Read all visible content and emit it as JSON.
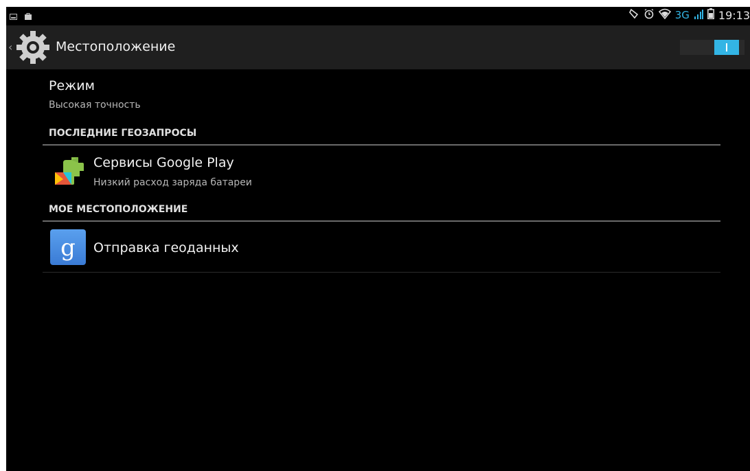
{
  "status_bar": {
    "icons_left": [
      "image-icon",
      "shopping-bag-icon"
    ],
    "icons_right": [
      "rotation-lock-icon",
      "alarm-icon",
      "wifi-icon",
      "signal-icon",
      "battery-icon"
    ],
    "network_label": "3G",
    "time": "19:13"
  },
  "action_bar": {
    "title": "Местоположение",
    "toggle_on": true
  },
  "mode": {
    "title": "Режим",
    "value": "Высокая точность"
  },
  "sections": {
    "recent_requests": "ПОСЛЕДНИЕ ГЕОЗАПРОСЫ",
    "my_location": "МОЕ МЕСТОПОЛОЖЕНИЕ"
  },
  "recent_apps": [
    {
      "title": "Сервисы Google Play",
      "subtitle": "Низкий расход заряда батареи",
      "icon": "google-play-services-icon"
    }
  ],
  "my_location_items": [
    {
      "title": "Отправка геоданных",
      "icon": "google-search-icon"
    }
  ],
  "colors": {
    "accent": "#33b5e5",
    "background": "#000000",
    "action_bar": "#1f1f1f"
  }
}
